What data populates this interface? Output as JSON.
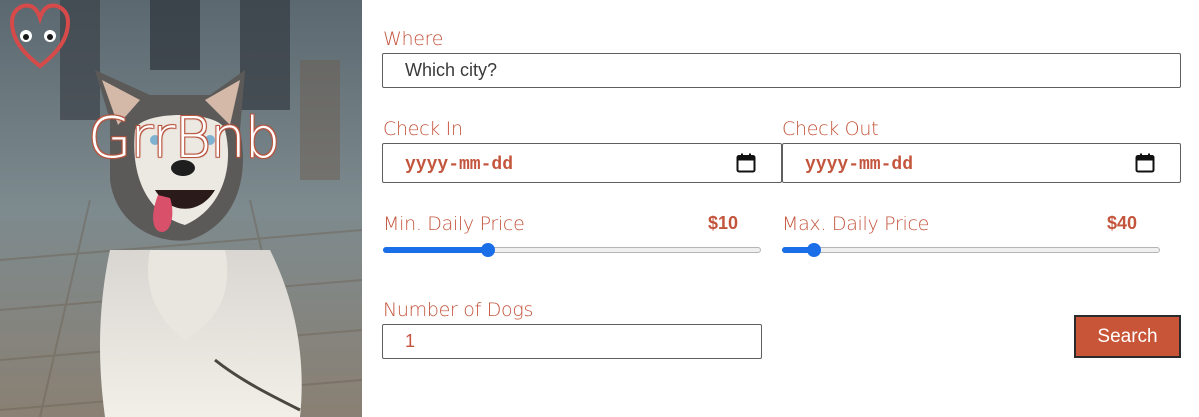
{
  "brand": {
    "name": "GrrBnb"
  },
  "search_form": {
    "where": {
      "label": "Where",
      "placeholder": "Which city?"
    },
    "check_in": {
      "label": "Check In",
      "placeholder": "yyyy-mm-dd"
    },
    "check_out": {
      "label": "Check Out",
      "placeholder": "yyyy-mm-dd"
    },
    "min_price": {
      "label": "Min. Daily Price",
      "value_text": "$10",
      "slider_fraction": 0.27
    },
    "max_price": {
      "label": "Max. Daily Price",
      "value_text": "$40",
      "slider_fraction": 0.07
    },
    "dogs": {
      "label": "Number of Dogs",
      "value": "1"
    },
    "search_label": "Search"
  },
  "colors": {
    "accent": "#c4553d",
    "slider": "#1a6ee8",
    "button": "#c85537"
  }
}
